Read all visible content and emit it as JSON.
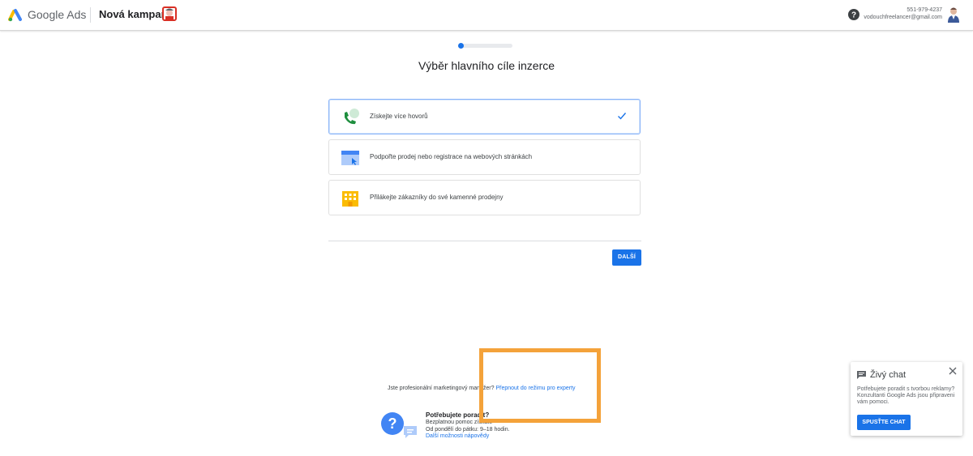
{
  "header": {
    "brand": "Google Ads",
    "campaign_title": "Nová kampaň",
    "account_phone": "551-979-4237",
    "account_email": "vodouchfreelancer@gmail.com"
  },
  "wizard": {
    "progress": 0.1,
    "title": "Výběr hlavního cíle inzerce",
    "options": [
      {
        "label": "Získejte více hovorů",
        "icon": "phone-icon",
        "selected": true
      },
      {
        "label": "Podpořte prodej nebo registrace na webových stránkách",
        "icon": "website-icon",
        "selected": false
      },
      {
        "label": "Přilákejte zákazníky do své kamenné prodejny",
        "icon": "store-icon",
        "selected": false
      }
    ],
    "next_label": "DALŠÍ"
  },
  "footer": {
    "pro_question": "Jste profesionální marketingový manažer?",
    "pro_link": "Přepnout do režimu pro experty",
    "need_title": "Potřebujete poradit?",
    "need_line1": "Bezplatnou pomoc získáte",
    "need_line2": "Od pondělí do pátku: 9–18 hodin.",
    "need_link": "Další možnosti nápovědy"
  },
  "chat": {
    "title": "Živý chat",
    "text": "Potřebujete poradit s tvorbou reklamy? Konzultanti Google Ads jsou připraveni vám pomoci.",
    "button": "SPUSŤTE CHAT"
  },
  "colors": {
    "accent": "#1a73e8",
    "highlight": "#f4a23a"
  }
}
